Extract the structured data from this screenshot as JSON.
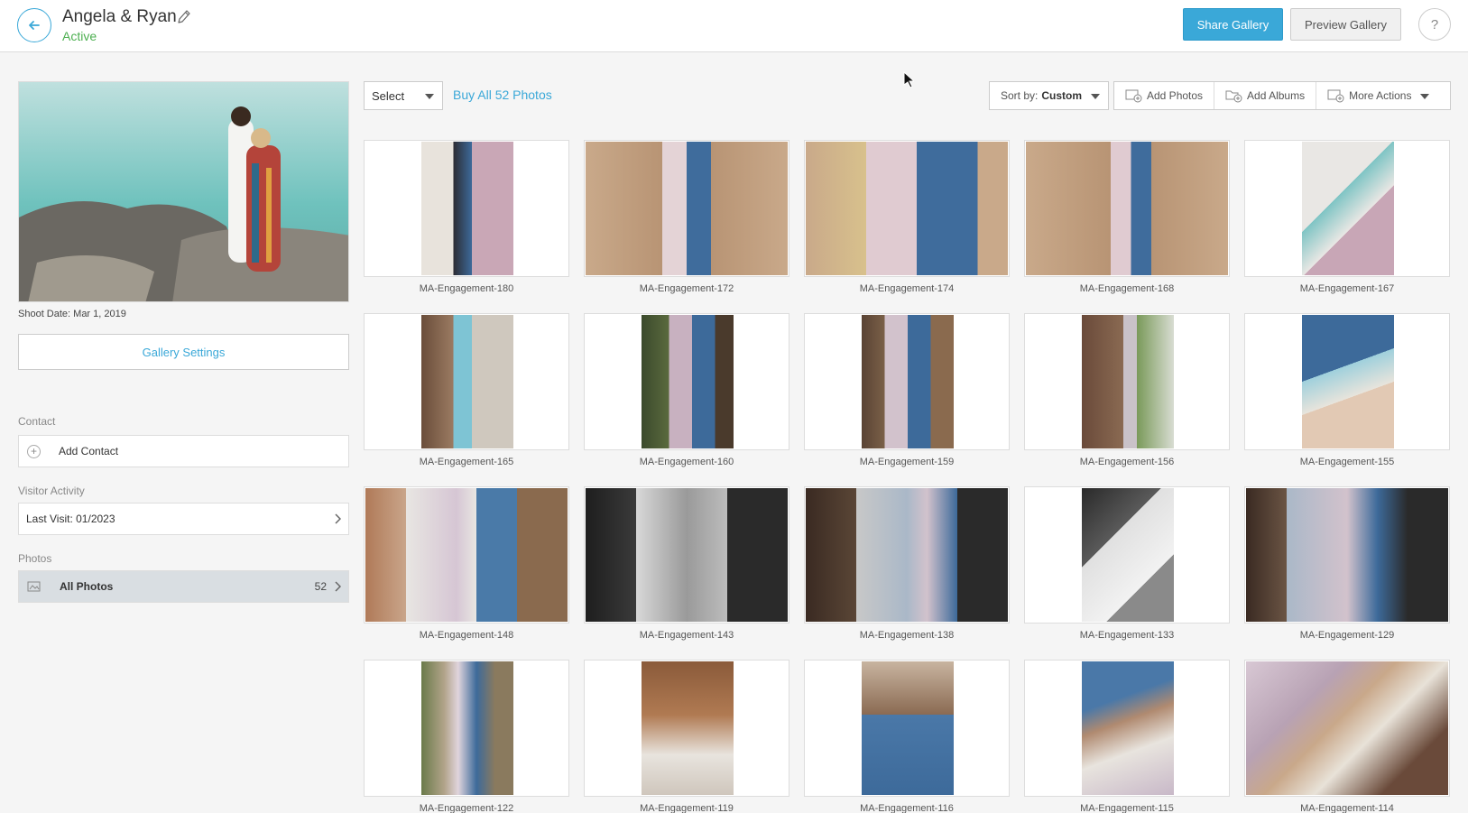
{
  "header": {
    "title": "Angela & Ryan",
    "status": "Active",
    "share_label": "Share Gallery",
    "preview_label": "Preview Gallery",
    "help_label": "?"
  },
  "sidebar": {
    "shoot_date": "Shoot Date: Mar 1, 2019",
    "settings_label": "Gallery Settings",
    "contact_label": "Contact",
    "add_contact_label": "Add Contact",
    "visitor_label": "Visitor Activity",
    "last_visit": "Last Visit: 01/2023",
    "photos_label": "Photos",
    "all_photos_label": "All Photos",
    "all_photos_count": "52"
  },
  "toolbar": {
    "select_label": "Select",
    "buy_all_label": "Buy All 52 Photos",
    "sort_prefix": "Sort by:",
    "sort_value": "Custom",
    "add_photos_label": "Add Photos",
    "add_albums_label": "Add Albums",
    "more_actions_label": "More Actions"
  },
  "photos": [
    {
      "name": "MA-Engagement-180"
    },
    {
      "name": "MA-Engagement-172"
    },
    {
      "name": "MA-Engagement-174"
    },
    {
      "name": "MA-Engagement-168"
    },
    {
      "name": "MA-Engagement-167"
    },
    {
      "name": "MA-Engagement-165"
    },
    {
      "name": "MA-Engagement-160"
    },
    {
      "name": "MA-Engagement-159"
    },
    {
      "name": "MA-Engagement-156"
    },
    {
      "name": "MA-Engagement-155"
    },
    {
      "name": "MA-Engagement-148"
    },
    {
      "name": "MA-Engagement-143"
    },
    {
      "name": "MA-Engagement-138"
    },
    {
      "name": "MA-Engagement-133"
    },
    {
      "name": "MA-Engagement-129"
    },
    {
      "name": "MA-Engagement-122"
    },
    {
      "name": "MA-Engagement-119"
    },
    {
      "name": "MA-Engagement-116"
    },
    {
      "name": "MA-Engagement-115"
    },
    {
      "name": "MA-Engagement-114"
    }
  ],
  "colors": {
    "accent": "#3aa8d8",
    "active_status": "#4caf50"
  }
}
